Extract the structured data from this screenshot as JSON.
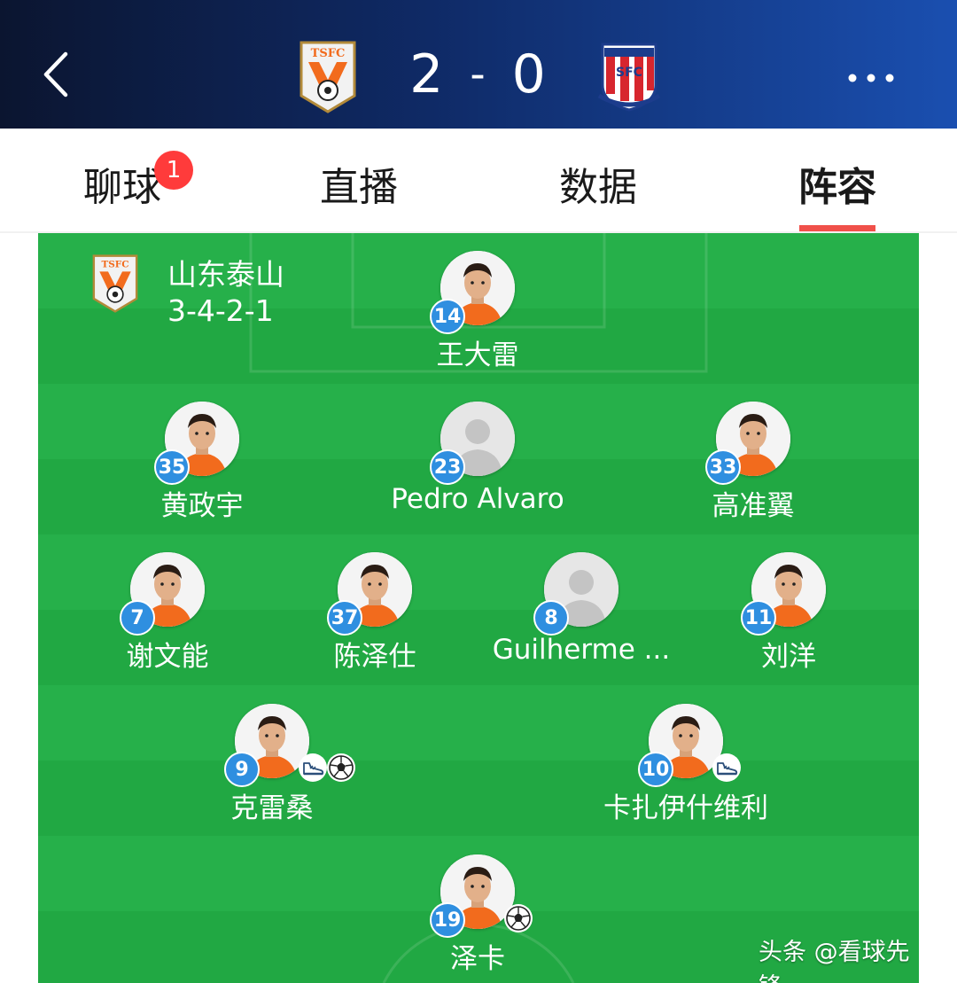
{
  "match": {
    "home_score": "2",
    "separator": "-",
    "away_score": "0",
    "home_crest_text": "TSFC",
    "away_crest_text": "SFC"
  },
  "tabs": [
    {
      "label": "聊球",
      "badge": "1"
    },
    {
      "label": "直播"
    },
    {
      "label": "数据"
    },
    {
      "label": "阵容",
      "active": true
    }
  ],
  "lineup": {
    "team_name": "山东泰山",
    "formation": "3-4-2-1",
    "players": [
      {
        "number": "14",
        "name": "王大雷",
        "photo": "photo",
        "events": []
      },
      {
        "number": "35",
        "name": "黄政宇",
        "photo": "photo",
        "events": []
      },
      {
        "number": "23",
        "name": "Pedro Alvaro",
        "photo": "placeholder",
        "events": []
      },
      {
        "number": "33",
        "name": "高准翼",
        "photo": "photo",
        "events": []
      },
      {
        "number": "7",
        "name": "谢文能",
        "photo": "photo",
        "events": []
      },
      {
        "number": "37",
        "name": "陈泽仕",
        "photo": "photo",
        "events": []
      },
      {
        "number": "8",
        "name": "Guilherme ...",
        "photo": "placeholder",
        "events": []
      },
      {
        "number": "11",
        "name": "刘洋",
        "photo": "photo",
        "events": []
      },
      {
        "number": "9",
        "name": "克雷桑",
        "photo": "photo",
        "events": [
          "assist-boot-icon",
          "goal-ball-icon"
        ]
      },
      {
        "number": "10",
        "name": "卡扎伊什维利",
        "photo": "photo",
        "events": [
          "assist-boot-icon"
        ]
      },
      {
        "number": "19",
        "name": "泽卡",
        "photo": "photo",
        "events": [
          "goal-ball-icon"
        ]
      }
    ]
  },
  "watermark": "头条 @看球先锋",
  "colors": {
    "header_dark": "#0b1530",
    "header_blue": "#1a4fb0",
    "pitch_green": "#26b04a",
    "number_badge": "#2f8fe0",
    "active_underline": "#f0504a",
    "notification_badge": "#ff3b3b",
    "home_orange": "#f26b1d"
  }
}
